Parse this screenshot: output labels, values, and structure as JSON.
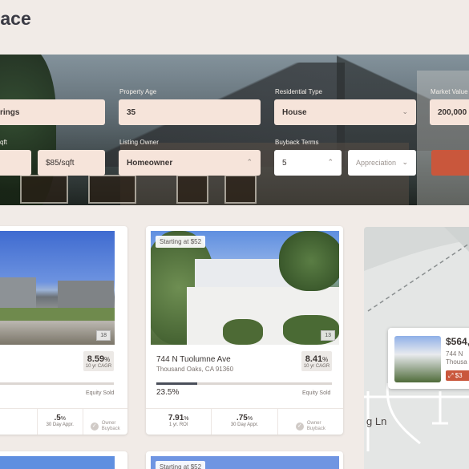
{
  "page": {
    "title": "lace"
  },
  "filters": {
    "location_value": "rings",
    "property_age": {
      "label": "Property Age",
      "value": "35"
    },
    "residential_type": {
      "label": "Residential Type",
      "value": "House"
    },
    "market_value": {
      "label": "Market Value",
      "value": "200,000"
    },
    "sqft": {
      "label": "qft",
      "value": "$85/sqft"
    },
    "listing_owner": {
      "label": "Listing Owner",
      "value": "Homeowner"
    },
    "buyback_terms": {
      "label": "Buyback Terms",
      "value": "5",
      "appreciation_placeholder": "Appreciation"
    }
  },
  "listings": [
    {
      "photo_count": "18",
      "cagr": "8.59",
      "cagr_unit": "%",
      "cagr_label": "10 yr CAGR",
      "equity_label": "Equity Sold",
      "equity_fraction": 0.0,
      "stat2": {
        "value": ".5",
        "unit": "%",
        "label": "30 Day Appr."
      },
      "owner": {
        "line1": "Owner",
        "line2": "Buyback"
      }
    },
    {
      "starting": "Starting at $52",
      "photo_count": "13",
      "address": "744 N Tuolumne Ave",
      "city": "Thousand Oaks, CA 91360",
      "cagr": "8.41",
      "cagr_unit": "%",
      "cagr_label": "10 yr CAGR",
      "equity_pct": "23.5%",
      "equity_fraction": 0.235,
      "equity_label": "Equity Sold",
      "stat1": {
        "value": "7.91",
        "unit": "%",
        "label": "1 yr. ROI"
      },
      "stat2": {
        "value": ".75",
        "unit": "%",
        "label": "30 Day Appr."
      },
      "owner": {
        "line1": "Owner",
        "line2": "Buyback"
      }
    },
    {
      "starting": "Starting at $52"
    }
  ],
  "map": {
    "popup": {
      "price": "$564,",
      "addr1": "744 N",
      "addr2": "Thousa",
      "tag": "$3"
    },
    "street": "g Ln"
  },
  "colors": {
    "accent": "#c9573c",
    "field_bg": "#f6e4da",
    "page_bg": "#f1ebe7"
  }
}
